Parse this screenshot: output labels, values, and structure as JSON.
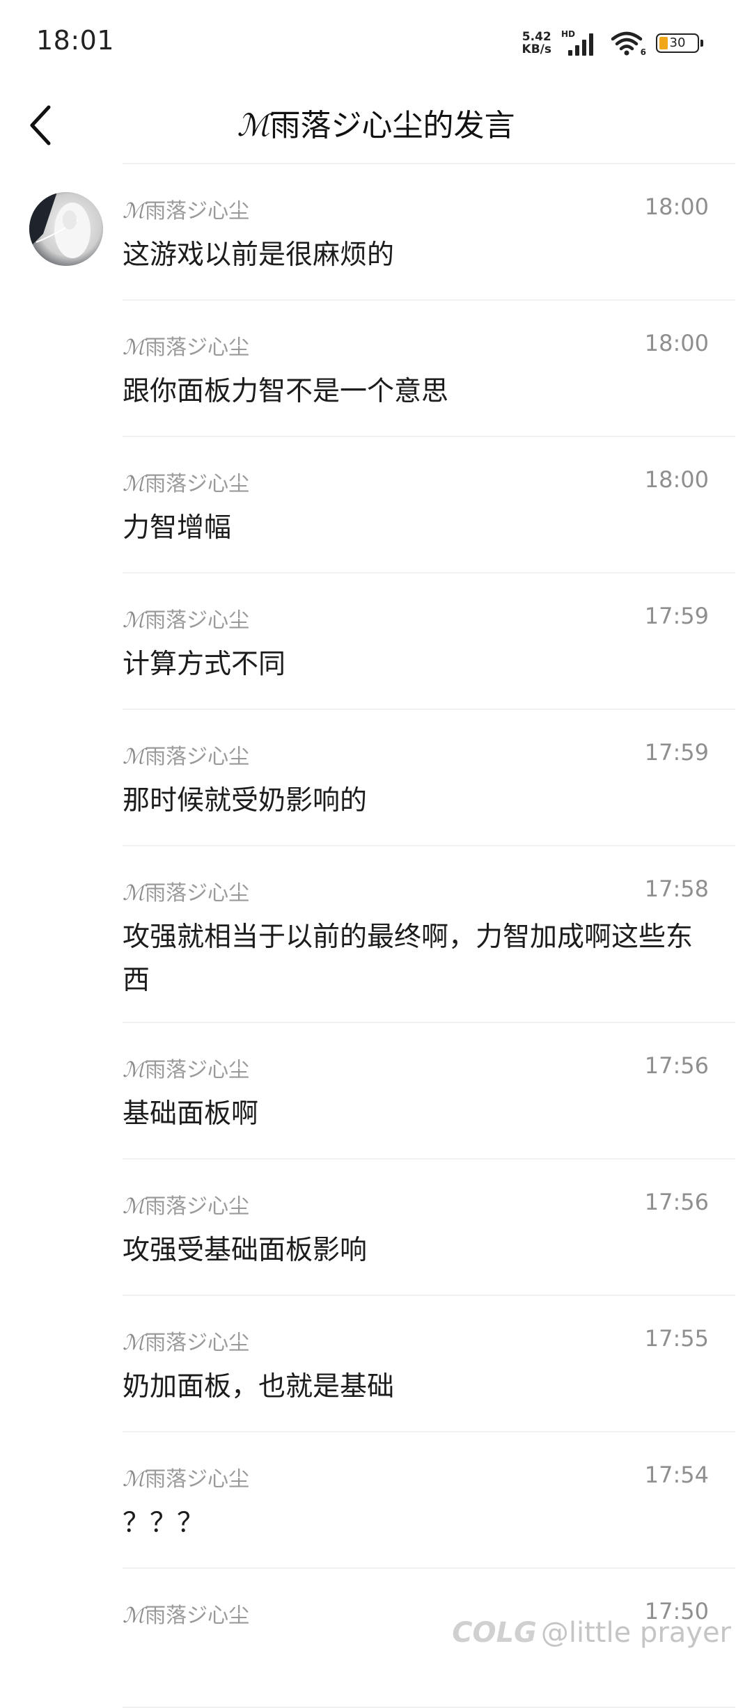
{
  "status_bar": {
    "time": "18:01",
    "net_speed_value": "5.42",
    "net_speed_unit": "KB/s",
    "hd_label": "HD",
    "wifi_sub": "6",
    "battery_level": "30",
    "battery_fill_color": "#f2a71b"
  },
  "header": {
    "title_prefix": "ℳ",
    "title_main": "雨落ジ心尘的发言",
    "back_icon": "chevron-left-icon"
  },
  "messages": [
    {
      "sender_prefix": "ℳ",
      "sender": "雨落ジ心尘",
      "time": "18:00",
      "text": "这游戏以前是很麻烦的"
    },
    {
      "sender_prefix": "ℳ",
      "sender": "雨落ジ心尘",
      "time": "18:00",
      "text": "跟你面板力智不是一个意思"
    },
    {
      "sender_prefix": "ℳ",
      "sender": "雨落ジ心尘",
      "time": "18:00",
      "text": "力智增幅"
    },
    {
      "sender_prefix": "ℳ",
      "sender": "雨落ジ心尘",
      "time": "17:59",
      "text": "计算方式不同"
    },
    {
      "sender_prefix": "ℳ",
      "sender": "雨落ジ心尘",
      "time": "17:59",
      "text": "那时候就受奶影响的"
    },
    {
      "sender_prefix": "ℳ",
      "sender": "雨落ジ心尘",
      "time": "17:58",
      "text": "攻强就相当于以前的最终啊，力智加成啊这些东西"
    },
    {
      "sender_prefix": "ℳ",
      "sender": "雨落ジ心尘",
      "time": "17:56",
      "text": "基础面板啊"
    },
    {
      "sender_prefix": "ℳ",
      "sender": "雨落ジ心尘",
      "time": "17:56",
      "text": "攻强受基础面板影响"
    },
    {
      "sender_prefix": "ℳ",
      "sender": "雨落ジ心尘",
      "time": "17:55",
      "text": "奶加面板，也就是基础"
    },
    {
      "sender_prefix": "ℳ",
      "sender": "雨落ジ心尘",
      "time": "17:54",
      "text": "？？？"
    },
    {
      "sender_prefix": "ℳ",
      "sender": "雨落ジ心尘",
      "time": "17:50",
      "text": ""
    }
  ],
  "watermark": {
    "logo": "COLG",
    "handle": "@little prayer"
  }
}
